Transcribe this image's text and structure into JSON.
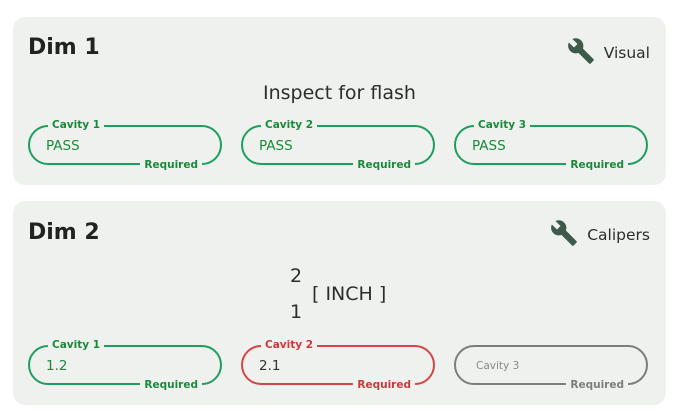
{
  "cards": [
    {
      "title": "Dim 1",
      "tool": {
        "label": "Visual",
        "icon": "wrench-icon"
      },
      "instruction": "Inspect for flash",
      "fields": [
        {
          "label": "Cavity 1",
          "value": "PASS",
          "required": "Required",
          "state": "valid"
        },
        {
          "label": "Cavity 2",
          "value": "PASS",
          "required": "Required",
          "state": "valid"
        },
        {
          "label": "Cavity 3",
          "value": "PASS",
          "required": "Required",
          "state": "valid"
        }
      ]
    },
    {
      "title": "Dim 2",
      "tool": {
        "label": "Calipers",
        "icon": "wrench-icon"
      },
      "spec": {
        "upper": "2",
        "lower": "1",
        "unit": "[ INCH ]"
      },
      "fields": [
        {
          "label": "Cavity 1",
          "value": "1.2",
          "required": "Required",
          "state": "valid"
        },
        {
          "label": "Cavity 2",
          "value": "2.1",
          "required": "Required",
          "state": "error"
        },
        {
          "placeholder": "Cavity 3",
          "value": "",
          "required": "Required",
          "state": "empty"
        }
      ]
    }
  ],
  "colors": {
    "valid": "#1e9e5e",
    "error": "#d64545",
    "empty": "#7d7d7d",
    "card_background": "#eff1ef"
  }
}
